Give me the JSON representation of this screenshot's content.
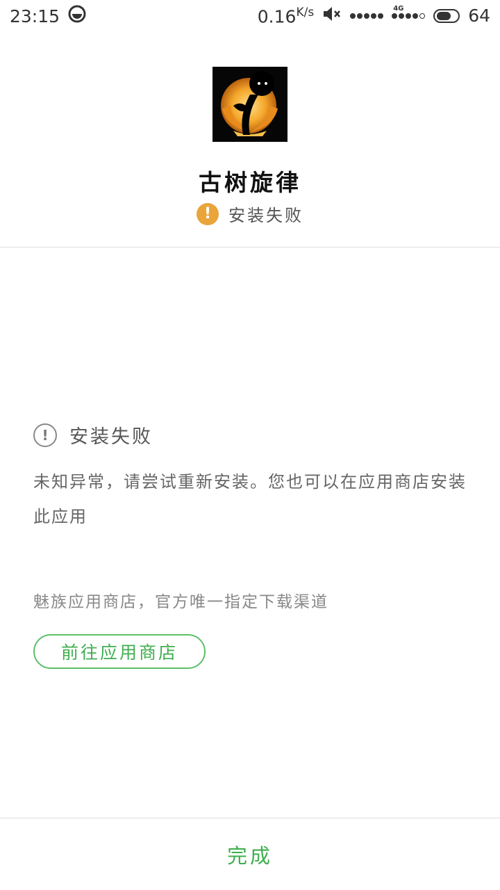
{
  "status_bar": {
    "time": "23:15",
    "net_speed_value": "0.16",
    "net_speed_unit": "K/s",
    "network_type": "4G",
    "battery_level": "64",
    "icons": [
      "notification-icon",
      "mute-icon",
      "signal-dots-icon",
      "battery-icon"
    ]
  },
  "app": {
    "name": "古树旋律",
    "status_text": "安装失败",
    "status_color": "#e9a43a"
  },
  "error": {
    "title": "安装失败",
    "description": "未知异常，请尝试重新安装。您也可以在应用商店安装此应用"
  },
  "store": {
    "note": "魅族应用商店，官方唯一指定下载渠道",
    "button_label": "前往应用商店",
    "accent_color": "#3fae4f"
  },
  "footer": {
    "done_label": "完成"
  }
}
